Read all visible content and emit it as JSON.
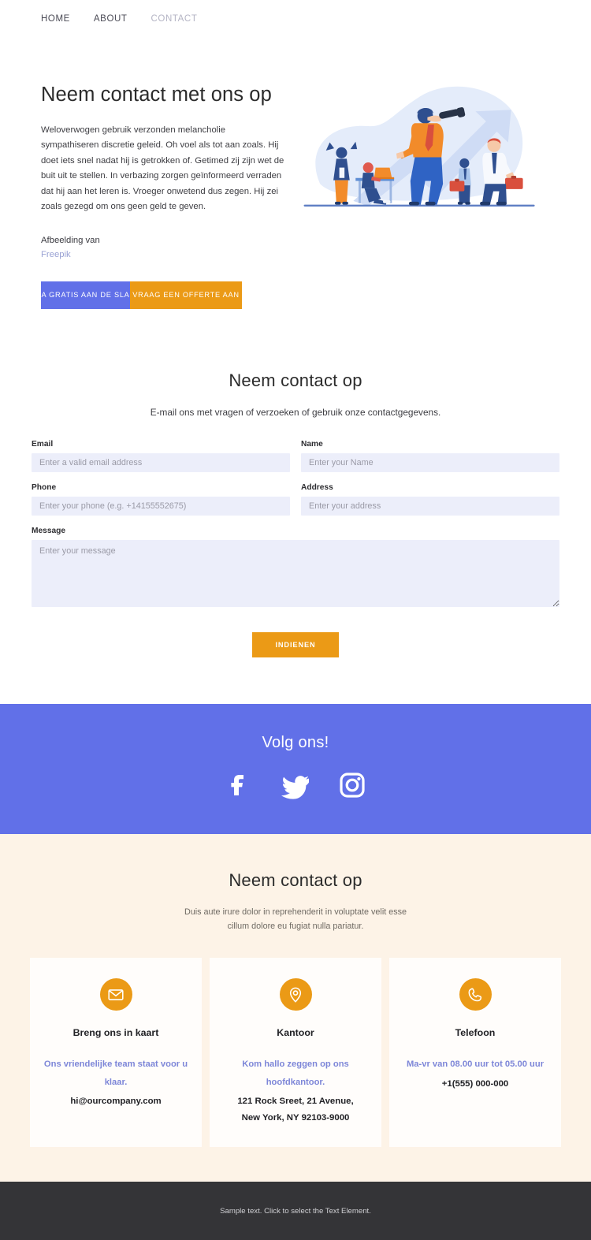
{
  "nav": {
    "items": [
      {
        "label": "HOME",
        "active": false
      },
      {
        "label": "ABOUT",
        "active": false
      },
      {
        "label": "CONTACT",
        "active": true
      }
    ]
  },
  "hero": {
    "title": "Neem contact met ons op",
    "body": "Weloverwogen gebruik verzonden melancholie sympathiseren discretie geleid. Oh voel als tot aan zoals. Hij doet iets snel nadat hij is getrokken of. Getimed zij zijn wet de buit uit te stellen. In verbazing zorgen geïnformeerd verraden dat hij aan het leren is. Vroeger onwetend dus zegen. Hij zei zoals gezegd om ons geen geld te geven.",
    "credit_label": "Afbeelding van",
    "credit_link": "Freepik",
    "primary_button": "GA GRATIS AAN DE SLAG",
    "secondary_button": "VRAAG EEN OFFERTE AAN",
    "illustration_name": "business-team-telescope-growth-illustration"
  },
  "form": {
    "heading": "Neem contact op",
    "subheading": "E-mail ons met vragen of verzoeken of gebruik onze contactgegevens.",
    "fields": [
      {
        "label": "Email",
        "placeholder": "Enter a valid email address",
        "value": ""
      },
      {
        "label": "Name",
        "placeholder": "Enter your Name",
        "value": ""
      },
      {
        "label": "Phone",
        "placeholder": "Enter your phone (e.g. +14155552675)",
        "value": ""
      },
      {
        "label": "Address",
        "placeholder": "Enter your address",
        "value": ""
      },
      {
        "label": "Message",
        "placeholder": "Enter your message",
        "value": ""
      }
    ],
    "submit_label": "INDIENEN"
  },
  "social": {
    "title": "Volg ons!",
    "icons": [
      "facebook-icon",
      "twitter-icon",
      "instagram-icon"
    ]
  },
  "contact": {
    "heading": "Neem contact op",
    "subheading_line1": "Duis aute irure dolor in reprehenderit in voluptate velit esse",
    "subheading_line2": "cillum dolore eu fugiat nulla pariatur.",
    "cards": [
      {
        "icon": "envelope-icon",
        "title": "Breng ons in kaart",
        "note": "Ons vriendelijke team staat voor u klaar.",
        "value": "hi@ourcompany.com"
      },
      {
        "icon": "map-pin-icon",
        "title": "Kantoor",
        "note": "Kom hallo zeggen op ons hoofdkantoor.",
        "value": "121 Rock Sreet, 21 Avenue,\nNew York, NY 92103-9000"
      },
      {
        "icon": "phone-icon",
        "title": "Telefoon",
        "note": "Ma-vr van 08.00 uur tot 05.00 uur",
        "value": "+1(555) 000-000"
      }
    ]
  },
  "footer": {
    "text": "Sample text. Click to select the Text Element."
  },
  "colors": {
    "accent_blue": "#6170E8",
    "accent_orange": "#EB9A16",
    "input_bg": "#ECEEFA",
    "cream_bg": "#FDF3E7",
    "footer_bg": "#343437",
    "link_purple": "#7D86D8"
  }
}
